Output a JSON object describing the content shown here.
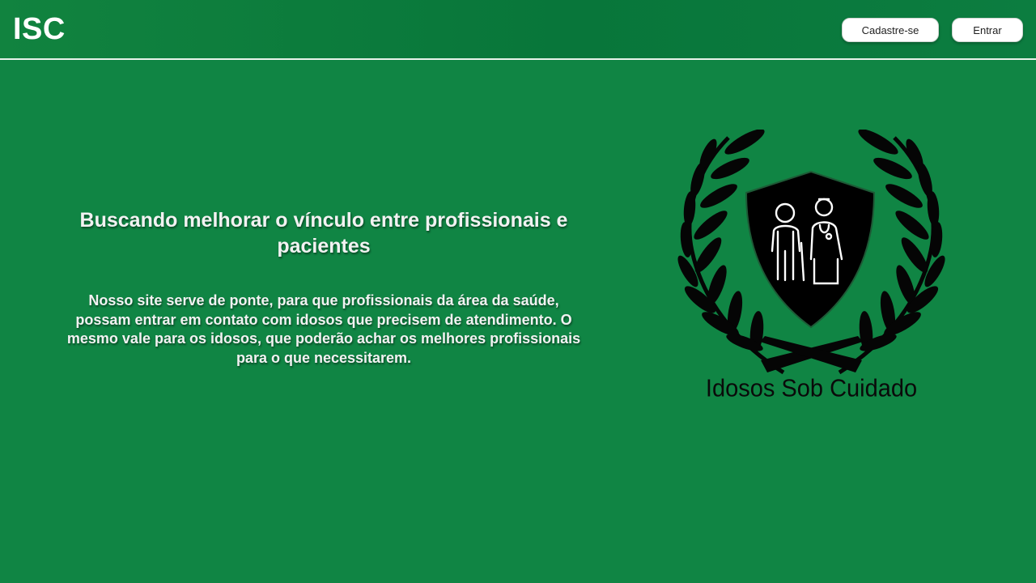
{
  "header": {
    "brand": "ISC",
    "signup_label": "Cadastre-se",
    "login_label": "Entrar"
  },
  "hero": {
    "title": "Buscando melhorar o vínculo entre profissionais e pacientes",
    "description": "Nosso site serve de ponte, para que profissionais da área da saúde, possam entrar em contato com idosos que precisem de atendimento. O mesmo vale para os idosos, que poderão achar os melhores profissionais para o que necessitarem."
  },
  "logo": {
    "caption": "Idosos Sob Cuidado",
    "icon": "laurel-shield-elderly-caregiver-icon"
  },
  "colors": {
    "background": "#108544",
    "header": "#08763a",
    "text": "#f2f2f2",
    "button": "#ffffff"
  }
}
